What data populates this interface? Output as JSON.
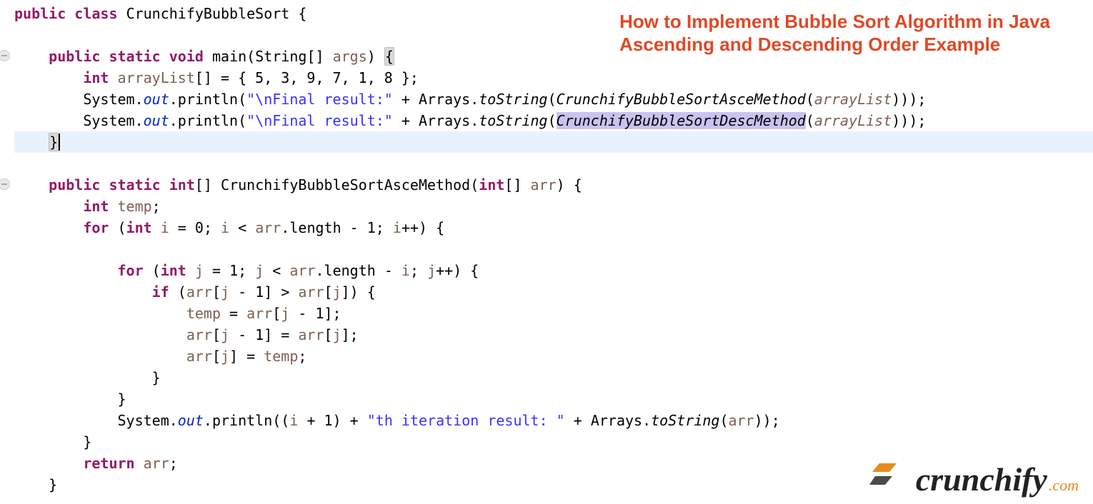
{
  "annotation": {
    "line1": "How to Implement Bubble Sort Algorithm in Java",
    "line2": "Ascending and Descending Order Example"
  },
  "logo": {
    "word": "crunchify",
    "suffix": ".com"
  },
  "code": {
    "keywords": {
      "public": "public",
      "class": "class",
      "static": "static",
      "void": "void",
      "int": "int",
      "for": "for",
      "if": "if",
      "return": "return"
    },
    "identifiers": {
      "className": "CrunchifyBubbleSort",
      "main": "main",
      "StringArr": "String[]",
      "args": "args",
      "arrayList": "arrayList",
      "System": "System",
      "out": "out",
      "println": "println",
      "Arrays": "Arrays",
      "toString": "toString",
      "AsceMethod": "CrunchifyBubbleSortAsceMethod",
      "DescMethod": "CrunchifyBubbleSortDescMethod",
      "arr": "arr",
      "temp": "temp",
      "i": "i",
      "j": "j",
      "length": "length"
    },
    "literals": {
      "arrayInit": "{ 5, 3, 9, 7, 1, 8 }",
      "zero": "0",
      "one": "1",
      "finalResult": "\"\\nFinal result:\"",
      "iterResult": "\"th iteration result: \""
    }
  }
}
